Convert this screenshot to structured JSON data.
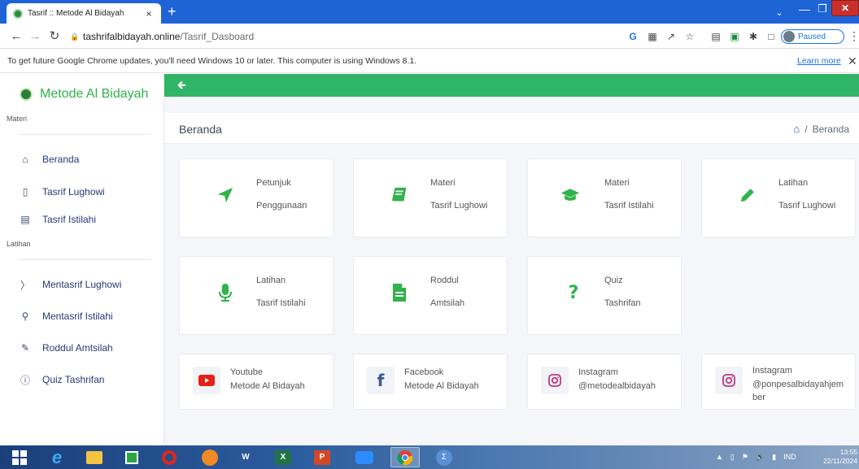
{
  "browser": {
    "tab_title": "Tasrif :: Metode Al Bidayah",
    "tab_close": "×",
    "new_tab": "+",
    "url_host": "tashrifalbidayah.online",
    "url_path": "/Tasrif_Dasboard",
    "profile_status": "Paused",
    "infobar_text": "To get future Google Chrome updates, you'll need Windows 10 or later. This computer is using Windows 8.1.",
    "infobar_link": "Learn more"
  },
  "sidebar": {
    "brand": "Metode Al Bidayah",
    "section_materi": "Materi",
    "section_latihan": "Latihan",
    "materi_items": [
      {
        "label": "Beranda",
        "icon": "home-icon"
      },
      {
        "label": "Tasrif Lughowi",
        "icon": "book-icon"
      },
      {
        "label": "Tasrif Istilahi",
        "icon": "book-open-icon"
      }
    ],
    "latihan_items": [
      {
        "label": "Mentasrif Lughowi",
        "icon": "tag-icon"
      },
      {
        "label": "Mentasrif Istilahi",
        "icon": "lightbulb-icon"
      },
      {
        "label": "Roddul Amtsilah",
        "icon": "pencil-icon"
      },
      {
        "label": "Quiz Tashrifan",
        "icon": "help-icon"
      }
    ]
  },
  "header": {
    "title": "Beranda",
    "breadcrumb_sep": "/",
    "breadcrumb_current": "Beranda"
  },
  "cards": [
    {
      "line1": "Petunjuk",
      "line2": "Penggunaan",
      "icon": "send-icon"
    },
    {
      "line1": "Materi",
      "line2": "Tasrif Lughowi",
      "icon": "book-icon"
    },
    {
      "line1": "Materi",
      "line2": "Tasrif Istilahi",
      "icon": "graduation-cap-icon"
    },
    {
      "line1": "Latihan",
      "line2": "Tasrif Lughowi",
      "icon": "pencil-icon"
    },
    {
      "line1": "Latihan",
      "line2": "Tasrif Istilahi",
      "icon": "microphone-icon"
    },
    {
      "line1": "Roddul",
      "line2": "Amtsilah",
      "icon": "file-text-icon"
    },
    {
      "line1": "Quiz",
      "line2": "Tashrifan",
      "icon": "question-icon"
    }
  ],
  "social": [
    {
      "line1": "Youtube",
      "line2": "Metode Al Bidayah",
      "icon": "youtube-icon"
    },
    {
      "line1": "Facebook",
      "line2": "Metode Al Bidayah",
      "icon": "facebook-icon"
    },
    {
      "line1": "Instagram",
      "line2": "@metodealbidayah",
      "icon": "instagram-icon"
    },
    {
      "line1": "Instagram",
      "line2": "@ponpesalbidayahjember",
      "icon": "instagram-icon"
    }
  ],
  "taskbar": {
    "language": "IND",
    "time": "13:55",
    "date": "22/11/2024"
  },
  "colors": {
    "green": "#2fb565",
    "brand_text": "#2fb34a",
    "sidebar_text": "#253a75",
    "youtube_red": "#e62117",
    "facebook_blue": "#3b5998",
    "instagram_pink": "#c13584"
  }
}
